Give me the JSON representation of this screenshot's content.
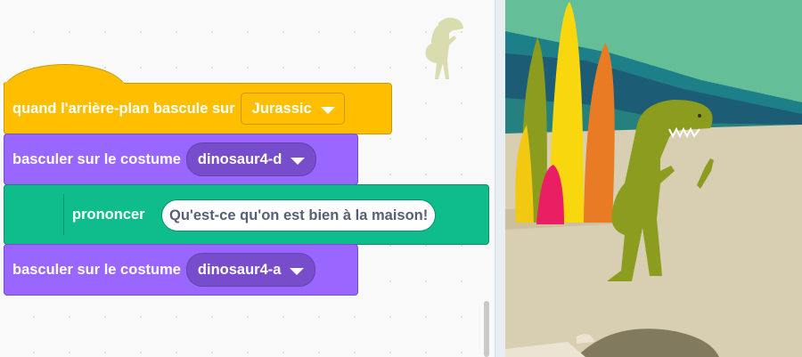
{
  "script": {
    "event_block": {
      "label": "quand l'arrière-plan bascule sur",
      "dropdown_value": "Jurassic"
    },
    "costume_block_1": {
      "label": "basculer sur le costume",
      "dropdown_value": "dinosaur4-d"
    },
    "say_block": {
      "label": "prononcer",
      "text_value": "Qu'est-ce qu'on est bien à la maison!"
    },
    "costume_block_2": {
      "label": "basculer sur le costume",
      "dropdown_value": "dinosaur4-a"
    }
  },
  "icons": {
    "dropdown_arrow": "chevron-down-icon",
    "sprite_thumbnail": "dinosaur-icon"
  },
  "colors": {
    "events": "#ffbf00",
    "looks": "#9966ff",
    "looks_dropdown": "#774dcb",
    "extension": "#0fbd8c",
    "stage_sky": "#64bf98",
    "stage_ground": "#d8ceb1",
    "dinosaur": "#8c9c1e"
  }
}
